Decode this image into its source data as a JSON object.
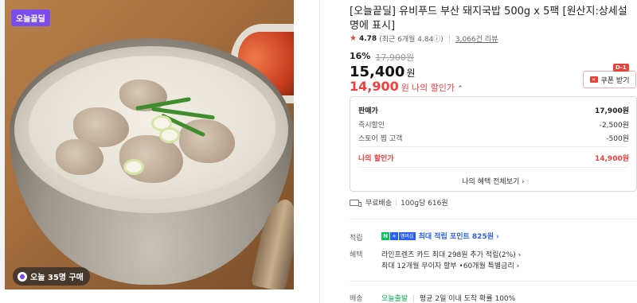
{
  "image": {
    "tag": "오늘끝딜",
    "buyers_badge": "오늘 35명 구매"
  },
  "product": {
    "title": "[오늘끝딜] 유비푸드 부산 돼지국밥 500g x 5팩 [원산지:상세설명에 표시]",
    "rating": "4.78",
    "recent_rating": "(최근 6개월 4.84ⓘ)",
    "reviews": "3,066건 리뷰",
    "discount_pct": "16%",
    "original_price": "17,900원",
    "price": "15,400",
    "price_unit": "원",
    "my_price": "14,900",
    "my_price_unit": "원",
    "my_price_label": "나의 할인가",
    "my_price_chevron": "⌃"
  },
  "coupon": {
    "label": "쿠폰 받기",
    "dday": "D-1",
    "icon": "coupon-icon"
  },
  "breakdown": {
    "rows": [
      {
        "label": "판매가",
        "value": "17,900원"
      },
      {
        "label": "즉시할인",
        "value": "-2,500원"
      },
      {
        "label": "스토어 찜 고객",
        "value": "-500원"
      },
      {
        "label": "나의 할인가",
        "value": "14,900원"
      }
    ],
    "all_benefits": "나의 혜택 전체보기 ›"
  },
  "shipping": {
    "label": "무료배송",
    "unit_price": "100g당 616원"
  },
  "points": {
    "label": "적립",
    "npay_n": "N",
    "npay_plus": "+",
    "npay_member": "멤버십",
    "text": "최대 적립 포인트 825원 ›"
  },
  "benefits": {
    "label": "혜택",
    "line1": "라인프렌즈 카드 최대 298원 추가 적립(2%) ›",
    "line2": "최대 12개월 무이자 할부 •60개월 특별금리 ›"
  },
  "delivery": {
    "label": "배송",
    "highlight": "오늘출발",
    "text": "평균 2일 이내 도착 확률 100%"
  },
  "colors": {
    "accent": "#f23e3e",
    "tag": "#7a4cf0",
    "npay_green": "#03c75a",
    "point_blue": "#2b5ff1"
  }
}
